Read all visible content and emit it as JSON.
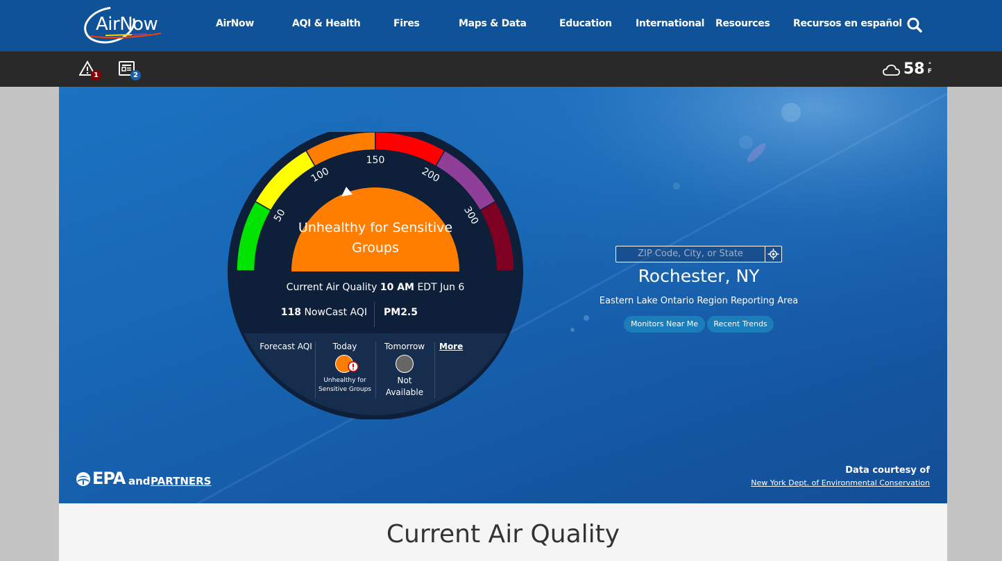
{
  "header": {
    "logo_text": "AirNow",
    "nav": [
      "AirNow",
      "AQI & Health",
      "Fires",
      "Maps & Data",
      "Education",
      "International",
      "Resources",
      "Recursos en español"
    ]
  },
  "subbar": {
    "alerts_count": "1",
    "news_count": "2",
    "temperature": "58",
    "temp_unit_top": "°",
    "temp_unit_bottom": "F"
  },
  "gauge": {
    "scale_labels": [
      "50",
      "100",
      "150",
      "200",
      "300"
    ],
    "category": "Unhealthy for Sensitive Groups",
    "current_label": "Current Air Quality",
    "current_time": "10 AM",
    "current_date": "EDT Jun 6",
    "aqi_value": "118",
    "aqi_label": "NowCast AQI",
    "pollutant": "PM2.5",
    "aqi_numeric": 118,
    "colors": {
      "good": "#00e400",
      "moderate": "#ffff00",
      "usg": "#ff7e00",
      "unhealthy": "#ff0000",
      "very_unhealthy": "#8f3f97",
      "hazardous": "#7e0023"
    }
  },
  "forecast": {
    "label": "Forecast AQI",
    "today_label": "Today",
    "today_category": "Unhealthy for Sensitive Groups",
    "today_color": "#ff7e00",
    "tomorrow_label": "Tomorrow",
    "tomorrow_status": "Not Available",
    "tomorrow_color": "#666666",
    "more_label": "More"
  },
  "location": {
    "search_placeholder": "ZIP Code, City, or State",
    "city": "Rochester, NY",
    "region": "Eastern Lake Ontario Region Reporting Area",
    "monitors_button": "Monitors Near Me",
    "trends_button": "Recent Trends"
  },
  "footer": {
    "epa_text": "EPA",
    "and_text": "and",
    "partners_text": "PARTNERS",
    "courtesy_label": "Data courtesy of",
    "courtesy_org": "New York Dept. of Environmental Conservation"
  },
  "main": {
    "title": "Current Air Quality"
  }
}
